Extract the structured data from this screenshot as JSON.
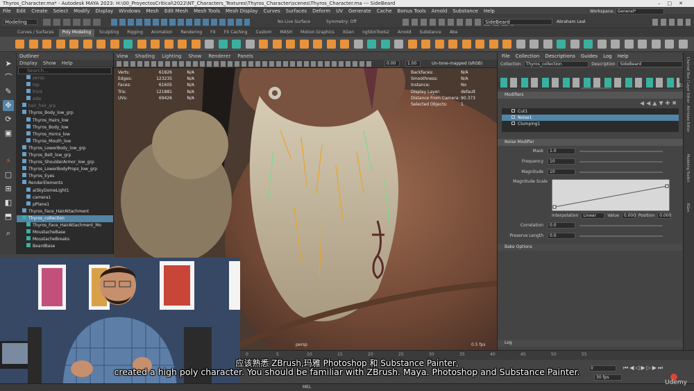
{
  "window": {
    "title": "Thyros_Character.ma* - Autodesk MAYA 2023: H:\\00_ProyectosCritical\\2022\\NT_Characters_Textures\\Thyros_Character\\scenes\\Thyros_Character.ma  ---  SideBeard"
  },
  "menubar": [
    "File",
    "Edit",
    "Create",
    "Select",
    "Modify",
    "Display",
    "Windows",
    "Mesh",
    "Edit Mesh",
    "Mesh Tools",
    "Mesh Display",
    "Curves",
    "Surfaces",
    "Deform",
    "UV",
    "Generate",
    "Cache",
    "Bonus Tools",
    "Arnold",
    "Substance",
    "Help"
  ],
  "workspace": {
    "label": "Workspace:",
    "value": "General*"
  },
  "status": {
    "menuset": "Modeling",
    "live_surface": "No Live Surface",
    "symmetry": "Symmetry: Off",
    "search_value": "SideBeard",
    "user": "Abraham Leal"
  },
  "shelf_tabs": [
    "Curves / Surfaces",
    "Poly Modeling",
    "Sculpting",
    "Rigging",
    "Animation",
    "Rendering",
    "FX",
    "FX Caching",
    "Custom",
    "MASH",
    "Motion Graphics",
    "XGen",
    "ngSkinTools2",
    "Arnold",
    "Substance",
    "Abe"
  ],
  "outliner": {
    "title": "Outliner",
    "menu": [
      "Display",
      "Show",
      "Help"
    ],
    "search_placeholder": "Search...",
    "rows": [
      "persp",
      "top",
      "front",
      "side",
      "hair_hair_grp",
      "Thyros_Body_low_grp",
      "Thyros_Hairs_low",
      "Thyros_Body_low",
      "Thyros_Horns_low",
      "Thyros_Mouth_low",
      "Thyros_LowerBody_low_grp",
      "Thyros_Belt_low_grp",
      "Thyros_ShoulderArmor_low_grp",
      "Thyros_LowerBodyProps_low_grp",
      "Thyros_Eyes",
      "RenderElements",
      "aiSkyDomeLight1",
      "camera1",
      "pPlane1",
      "Thyros_Face_HairAttachment",
      "Thyros_collection",
      "Thyros_Face_HairAttachment_Mo",
      "MoustacheBase",
      "MoustacheBreaks",
      "BeardBase"
    ]
  },
  "viewport": {
    "menu": [
      "View",
      "Shading",
      "Lighting",
      "Show",
      "Renderer",
      "Panels"
    ],
    "exposure": "0.00",
    "gamma": "1.00",
    "colorspace": "Un-tone-mapped (sRGB)",
    "hud_left_labels": [
      "Verts:",
      "Edges:",
      "Faces:",
      "Tris:",
      "UVs:"
    ],
    "hud_left_values": [
      "61826",
      "123235",
      "61605",
      "121881",
      "69426"
    ],
    "hud_left_sel": [
      "N/A",
      "N/A",
      "N/A",
      "N/A",
      "N/A"
    ],
    "hud_right_labels": [
      "Backfaces:",
      "Smoothness:",
      "Instance:",
      "Display Layer:",
      "Distance From Camera:",
      "Selected Objects:"
    ],
    "hud_right_values": [
      "N/A",
      "N/A",
      "No",
      "default",
      "90.373",
      "1"
    ],
    "camera": "persp",
    "fps": "0.5 fps"
  },
  "xgen": {
    "menu": [
      "File",
      "Collection",
      "Descriptions",
      "Guides",
      "Log",
      "Help"
    ],
    "collection_label": "Collection",
    "collection_value": "Thyros_collection",
    "description_label": "Description",
    "description_value": "SideBeard",
    "tabs": [
      "Primitives",
      "Preview/Output",
      "Modifiers",
      "Grooming",
      "Utilities",
      "Expressions"
    ],
    "modifiers_header": "Modifiers",
    "modifiers": [
      "Cut1",
      "Noise1",
      "Clumping1"
    ],
    "noise_header": "Noise Modifier",
    "props": [
      {
        "label": "Mask",
        "value": "1.0"
      },
      {
        "label": "Frequency",
        "value": "10"
      },
      {
        "label": "Magnitude",
        "value": "10"
      }
    ],
    "ramp_label": "Magnitude Scale",
    "interp_label": "Interpolation",
    "interp_value": "Linear",
    "value_label": "Value",
    "value_val": "0.000",
    "position_label": "Position",
    "position_val": "0.000",
    "props2": [
      {
        "label": "Correlation",
        "value": "0.0"
      },
      {
        "label": "Preserve Length",
        "value": "0.0"
      }
    ],
    "bake_label": "Bake Options",
    "log_label": "Log"
  },
  "rightstrip": [
    "Channel Box / Layer Editor",
    "Attribute Editor",
    "Modeling Toolkit",
    "XGen"
  ],
  "timeline": {
    "current_frame": "0",
    "fps_value": "30 fps",
    "ticks": [
      "0",
      "5",
      "10",
      "15",
      "20",
      "25",
      "30",
      "35",
      "40",
      "45",
      "50",
      "55"
    ]
  },
  "cmd": {
    "label": "MEL"
  },
  "subtitles": {
    "zh": "应该熟悉 ZBrush,玛雅 Photoshop 和 Substance Painter,",
    "en": "created a high poly character. You should be familiar with ZBrush. Maya. Photoshop and Substance Painter."
  },
  "watermark": "Udemy",
  "colors": {
    "accent": "#5285a6",
    "shelf_orange": "#e8923a",
    "shelf_teal": "#3ab0a0",
    "record": "#d9443a"
  }
}
